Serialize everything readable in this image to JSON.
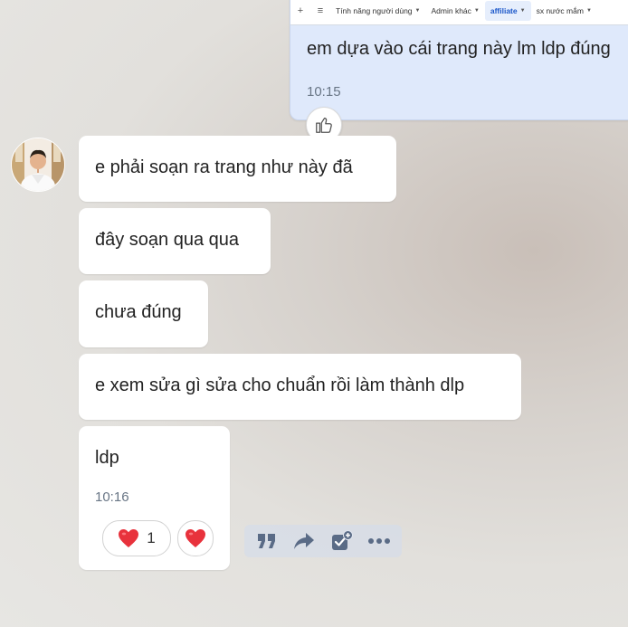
{
  "embedded_toolbar": {
    "plus": "+",
    "menu": "≡",
    "tabs": [
      {
        "label": "Tính năng người dùng",
        "caret": "▼",
        "active": false
      },
      {
        "label": "Admin khác",
        "caret": "▼",
        "active": false
      },
      {
        "label": "affiliate",
        "caret": "▼",
        "active": true
      },
      {
        "label": "sx nước mắm",
        "caret": "▼",
        "active": false
      }
    ]
  },
  "sent_message": {
    "text": "em dựa vào cái trang này lm ldp đúng",
    "time": "10:15"
  },
  "received_messages": [
    {
      "text": "e phải soạn ra trang như này đã"
    },
    {
      "text": "đây soạn qua qua"
    },
    {
      "text": "chưa đúng"
    },
    {
      "text": "e xem sửa gì sửa cho chuẩn rồi làm thành dlp"
    },
    {
      "text": "ldp",
      "time": "10:16"
    }
  ],
  "reactions": {
    "heart_count": "1"
  },
  "colors": {
    "sent_bubble": "#dfe9fb",
    "received_bubble": "#ffffff",
    "accent": "#1a56c9",
    "heart": "#e8323c",
    "toolbar_icon": "#5a6b86"
  }
}
